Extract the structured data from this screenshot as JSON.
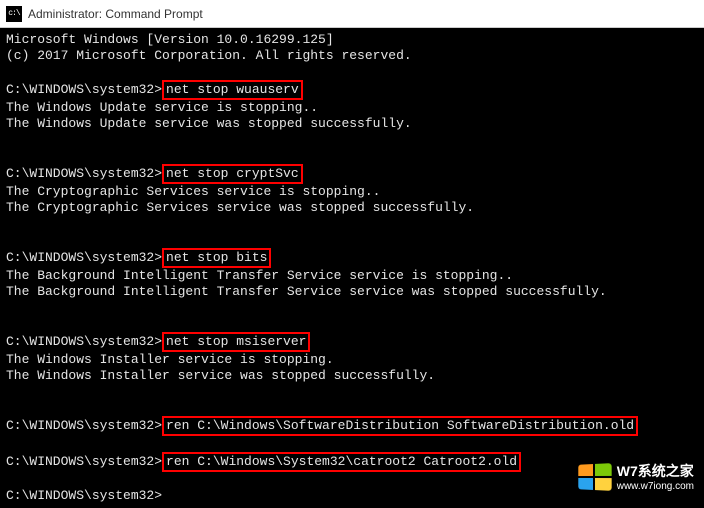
{
  "window": {
    "title": "Administrator: Command Prompt",
    "icon_glyph": "c:\\"
  },
  "terminal": {
    "prompt": "C:\\WINDOWS\\system32>",
    "header": {
      "version": "Microsoft Windows [Version 10.0.16299.125]",
      "copyright": "(c) 2017 Microsoft Corporation. All rights reserved."
    },
    "blocks": [
      {
        "cmd": "net stop wuauserv",
        "out": [
          "The Windows Update service is stopping..",
          "The Windows Update service was stopped successfully."
        ]
      },
      {
        "cmd": "net stop cryptSvc",
        "out": [
          "The Cryptographic Services service is stopping..",
          "The Cryptographic Services service was stopped successfully."
        ]
      },
      {
        "cmd": "net stop bits",
        "out": [
          "The Background Intelligent Transfer Service service is stopping..",
          "The Background Intelligent Transfer Service service was stopped successfully."
        ]
      },
      {
        "cmd": "net stop msiserver",
        "out": [
          "The Windows Installer service is stopping.",
          "The Windows Installer service was stopped successfully."
        ]
      },
      {
        "cmd": "ren C:\\Windows\\SoftwareDistribution SoftwareDistribution.old",
        "out": []
      },
      {
        "cmd": "ren C:\\Windows\\System32\\catroot2 Catroot2.old",
        "out": []
      }
    ],
    "trailing_prompt": "C:\\WINDOWS\\system32>"
  },
  "watermark": {
    "text": "W7系统之家",
    "sub": "www.w7iong.com"
  }
}
